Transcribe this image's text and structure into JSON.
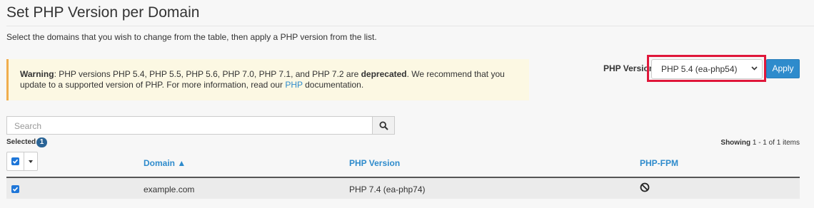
{
  "page": {
    "title": "Set PHP Version per Domain",
    "description": "Select the domains that you wish to change from the table, then apply a PHP version from the list."
  },
  "warning": {
    "strong": "Warning",
    "text1": ": PHP versions PHP 5.4, PHP 5.5, PHP 5.6, PHP 7.0, PHP 7.1, and PHP 7.2 are ",
    "deprecated": "deprecated",
    "text2": ". We recommend that you update to a supported version of PHP. For more information, read our ",
    "link": "PHP",
    "text3": " documentation."
  },
  "php_version": {
    "label": "PHP Version",
    "selected": "PHP 5.4 (ea-php54)",
    "apply_label": "Apply"
  },
  "search": {
    "placeholder": "Search"
  },
  "selection": {
    "label": "Selected",
    "count": "1"
  },
  "showing": {
    "label": "Showing",
    "range": "1 - 1 of 1 items"
  },
  "table": {
    "headers": {
      "domain": "Domain ▲",
      "php_version": "PHP Version",
      "php_fpm": "PHP-FPM"
    },
    "rows": [
      {
        "domain": "example.com",
        "php_version": "PHP 7.4 (ea-php74)",
        "php_fpm_icon": "disabled-icon",
        "checked": true
      }
    ]
  },
  "colors": {
    "accent": "#2e8bcc",
    "checkbox": "#1e76d8",
    "highlight": "#e0173a",
    "warning_border": "#f0ad4e"
  }
}
